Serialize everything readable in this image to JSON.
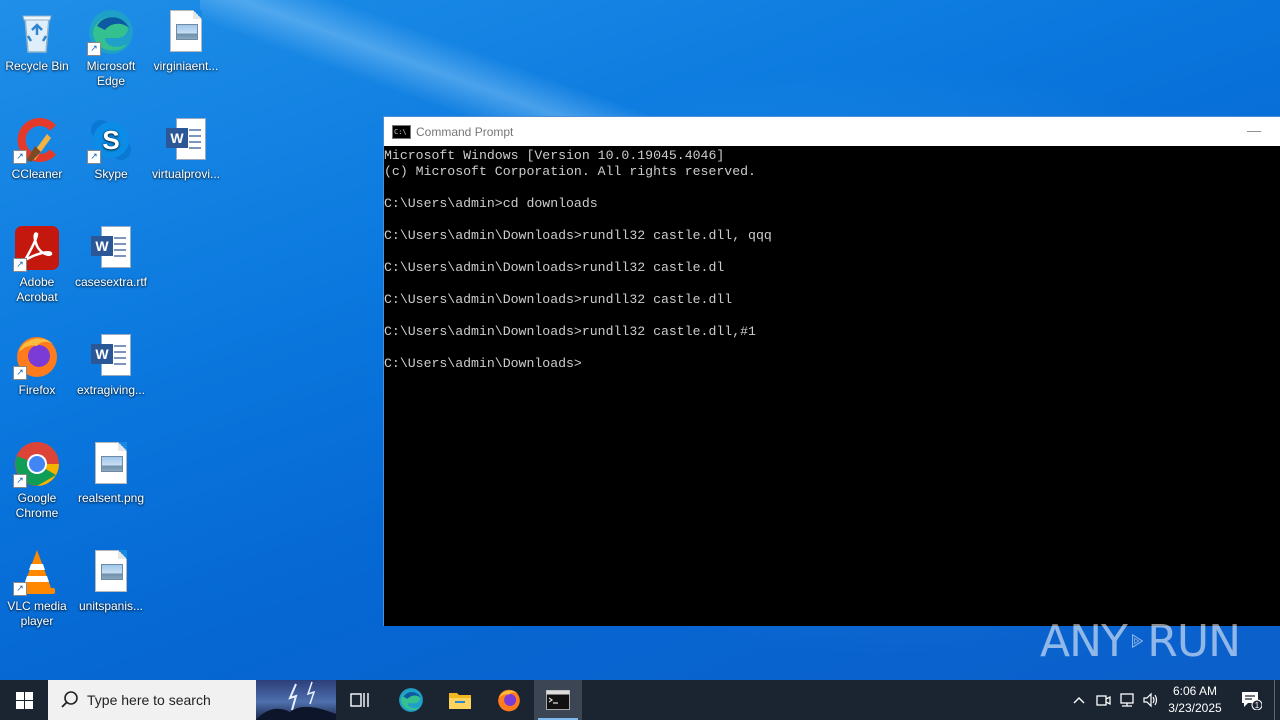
{
  "desktop": {
    "icons": [
      {
        "label": "Recycle Bin",
        "icon": "recycle-bin-icon"
      },
      {
        "label": "Microsoft Edge",
        "icon": "edge-icon"
      },
      {
        "label": "virginiaent...",
        "icon": "image-file-icon"
      },
      {
        "label": "CCleaner",
        "icon": "ccleaner-icon"
      },
      {
        "label": "Skype",
        "icon": "skype-icon"
      },
      {
        "label": "virtualprovi...",
        "icon": "word-doc-icon"
      },
      {
        "label": "Adobe Acrobat",
        "icon": "acrobat-icon"
      },
      {
        "label": "casesextra.rtf",
        "icon": "word-doc-icon"
      },
      {
        "label": "Firefox",
        "icon": "firefox-icon"
      },
      {
        "label": "extragiving...",
        "icon": "word-doc-icon"
      },
      {
        "label": "Google Chrome",
        "icon": "chrome-icon"
      },
      {
        "label": "realsent.png",
        "icon": "image-file-icon"
      },
      {
        "label": "VLC media player",
        "icon": "vlc-icon"
      },
      {
        "label": "unitspanis...",
        "icon": "image-file-icon"
      }
    ]
  },
  "cmd": {
    "title": "Command Prompt",
    "lines": [
      "Microsoft Windows [Version 10.0.19045.4046]",
      "(c) Microsoft Corporation. All rights reserved.",
      "",
      "C:\\Users\\admin>cd downloads",
      "",
      "C:\\Users\\admin\\Downloads>rundll32 castle.dll, qqq",
      "",
      "C:\\Users\\admin\\Downloads>rundll32 castle.dl",
      "",
      "C:\\Users\\admin\\Downloads>rundll32 castle.dll",
      "",
      "C:\\Users\\admin\\Downloads>rundll32 castle.dll,#1",
      "",
      "C:\\Users\\admin\\Downloads>"
    ],
    "minimize_glyph": "—"
  },
  "watermark": {
    "left": "ANY",
    "right": "RUN"
  },
  "taskbar": {
    "search_placeholder": "Type here to search",
    "time": "6:06 AM",
    "date": "3/23/2025",
    "notification_count": "1",
    "pinned": [
      "task-view-icon",
      "edge-icon",
      "file-explorer-icon",
      "firefox-icon",
      "cmd-icon"
    ]
  },
  "colors": {
    "console_text": "#cccccc",
    "taskbar": "#1b2431",
    "desktop_blue": "#0a78de"
  }
}
